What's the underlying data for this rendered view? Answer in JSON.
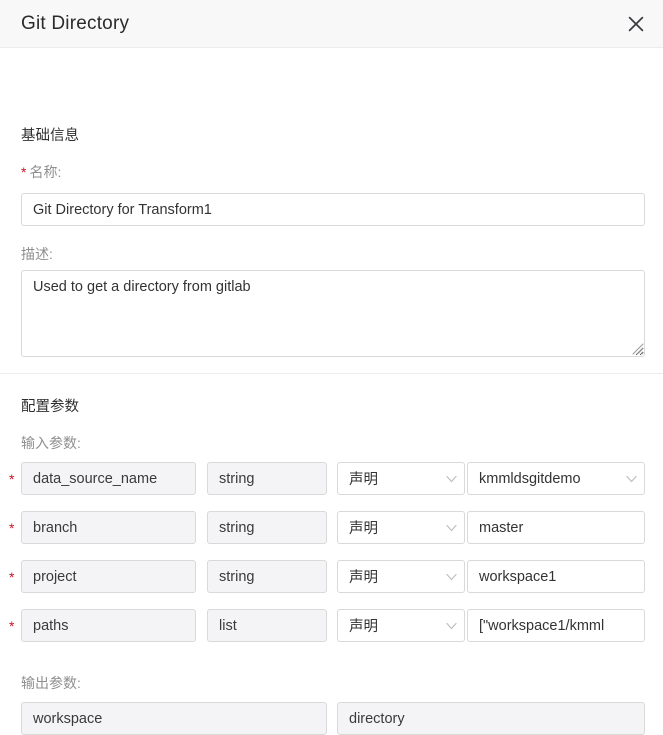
{
  "dialog": {
    "title": "Git Directory",
    "close_icon": "close-icon"
  },
  "basic_section": {
    "heading": "基础信息",
    "name_label": "名称:",
    "name_required_mark": "*",
    "name_value": "Git Directory for Transform1",
    "desc_label": "描述:",
    "desc_value": "Used to get a directory from gitlab"
  },
  "config_section": {
    "heading": "配置参数",
    "input_params_label": "输入参数:",
    "output_params_label": "输出参数:",
    "required_mark": "*",
    "input_params": [
      {
        "name": "data_source_name",
        "type": "string",
        "source": "声明",
        "value": "kmmldsgitdemo",
        "value_is_select": true
      },
      {
        "name": "branch",
        "type": "string",
        "source": "声明",
        "value": "master",
        "value_is_select": false
      },
      {
        "name": "project",
        "type": "string",
        "source": "声明",
        "value": "workspace1",
        "value_is_select": false
      },
      {
        "name": "paths",
        "type": "list",
        "source": "声明",
        "value": "[\"workspace1/kmml",
        "value_is_select": false
      }
    ],
    "output_params": [
      {
        "name": "workspace"
      },
      {
        "name": "directory"
      }
    ]
  },
  "colors": {
    "header_bg": "#f8f8f9",
    "border": "#d9d9d9",
    "required_red": "#cf1322",
    "label_gray": "#8f8f8f",
    "readonly_fill": "#f4f4f7"
  }
}
